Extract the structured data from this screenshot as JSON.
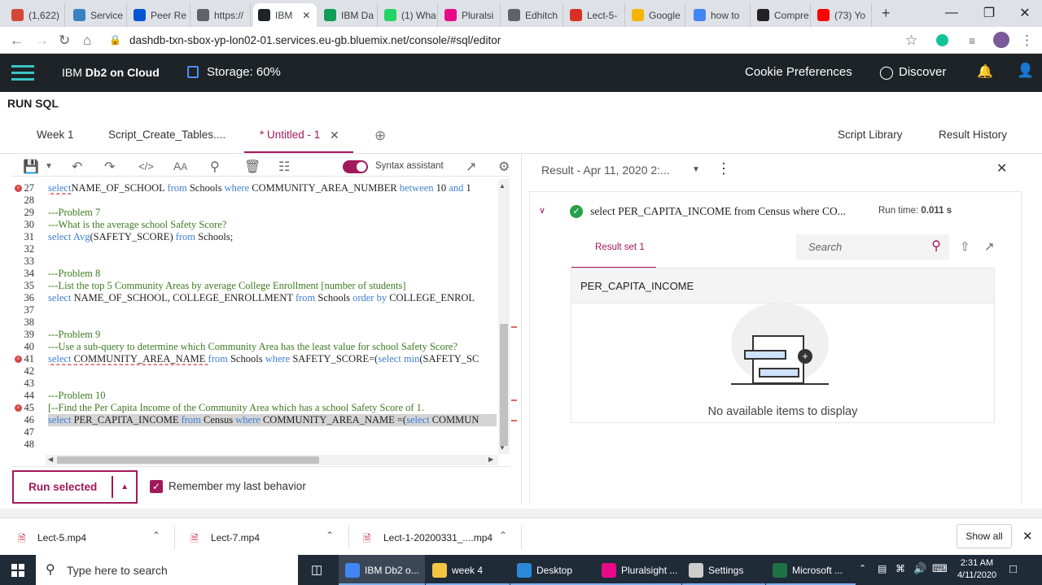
{
  "browser": {
    "tabs": [
      {
        "label": "(1,622)",
        "icon": "gmail-icon",
        "color": "#d44638"
      },
      {
        "label": "Service",
        "icon": "cloud-icon",
        "color": "#3b82c4"
      },
      {
        "label": "Peer Re",
        "icon": "coursera-icon",
        "color": "#0056d2"
      },
      {
        "label": "https://",
        "icon": "globe-icon",
        "color": "#5f6368"
      },
      {
        "label": "IBM",
        "icon": "ibm-icon",
        "color": "#1d2327"
      },
      {
        "label": "IBM Da",
        "icon": "sheets-icon",
        "color": "#0f9d58"
      },
      {
        "label": "(1) Wha",
        "icon": "whatsapp-icon",
        "color": "#25d366"
      },
      {
        "label": "Pluralsi",
        "icon": "pluralsight-icon",
        "color": "#e80a89"
      },
      {
        "label": "Edhitch",
        "icon": "globe-icon",
        "color": "#5f6368"
      },
      {
        "label": "Lect-5-",
        "icon": "calendar-icon",
        "color": "#d93025"
      },
      {
        "label": "Google",
        "icon": "drive-icon",
        "color": "#f4b400"
      },
      {
        "label": "how to",
        "icon": "google-icon",
        "color": "#4285f4"
      },
      {
        "label": "Compre",
        "icon": "ps-icon",
        "color": "#222"
      },
      {
        "label": "(73) Yo",
        "icon": "youtube-icon",
        "color": "#ff0000"
      }
    ],
    "new_tab": "+",
    "url": "dashdb-txn-sbox-yp-lon02-01.services.eu-gb.bluemix.net/console/#sql/editor"
  },
  "app": {
    "brand_prefix": "IBM",
    "brand_name": "Db2 on Cloud",
    "storage": "Storage: 60%",
    "cookie": "Cookie Preferences",
    "discover": "Discover"
  },
  "page": {
    "title": "RUN SQL",
    "tabs": [
      "Week 1",
      "Script_Create_Tables....",
      "* Untitled - 1"
    ],
    "script_library": "Script Library",
    "result_history": "Result History",
    "syntax_assistant": "Syntax assistant"
  },
  "editor": {
    "lines": [
      {
        "n": "27",
        "err": true,
        "parts": [
          [
            "kw",
            "select"
          ],
          [
            "",
            "NAME_OF_SCHOOL "
          ],
          [
            "kw",
            "from"
          ],
          [
            "",
            " Schools "
          ],
          [
            "kw",
            "where"
          ],
          [
            "",
            " COMMUNITY_AREA_NUMBER "
          ],
          [
            "kw",
            "between"
          ],
          [
            "",
            " 10 "
          ],
          [
            "kw",
            "and"
          ],
          [
            "",
            " 1"
          ]
        ]
      },
      {
        "n": "28",
        "parts": []
      },
      {
        "n": "29",
        "parts": [
          [
            "cm",
            "---Problem 7"
          ]
        ]
      },
      {
        "n": "30",
        "parts": [
          [
            "cm",
            "---What is the average school Safety Score?"
          ]
        ]
      },
      {
        "n": "31",
        "parts": [
          [
            "kw",
            "select"
          ],
          [
            "",
            " "
          ],
          [
            "kw",
            "Avg"
          ],
          [
            "",
            "(SAFETY_SCORE) "
          ],
          [
            "kw",
            "from"
          ],
          [
            "",
            " Schools;"
          ]
        ]
      },
      {
        "n": "32",
        "parts": []
      },
      {
        "n": "33",
        "parts": []
      },
      {
        "n": "34",
        "parts": [
          [
            "cm",
            "---Problem 8"
          ]
        ]
      },
      {
        "n": "35",
        "parts": [
          [
            "cm",
            "---List the top 5 Community Areas by average College Enrollment [number of students]"
          ]
        ]
      },
      {
        "n": "36",
        "parts": [
          [
            "kw",
            "select"
          ],
          [
            "",
            " NAME_OF_SCHOOL, COLLEGE_ENROLLMENT "
          ],
          [
            "kw",
            "from"
          ],
          [
            "",
            " Schools "
          ],
          [
            "kw",
            "order by"
          ],
          [
            "",
            " COLLEGE_ENROL"
          ]
        ]
      },
      {
        "n": "37",
        "parts": []
      },
      {
        "n": "38",
        "parts": []
      },
      {
        "n": "39",
        "parts": [
          [
            "cm",
            "---Problem 9"
          ]
        ]
      },
      {
        "n": "40",
        "parts": [
          [
            "cm",
            "---Use a sub-query to determine which Community Area has the least value for school Safety Score?"
          ]
        ]
      },
      {
        "n": "41",
        "err": true,
        "parts": [
          [
            "kw",
            "select"
          ],
          [
            "",
            " COMMUNITY_AREA_NAME "
          ],
          [
            "kw",
            "from"
          ],
          [
            "",
            " Schools "
          ],
          [
            "kw",
            "where"
          ],
          [
            "",
            " SAFETY_SCORE=("
          ],
          [
            "kw",
            "select"
          ],
          [
            "",
            " "
          ],
          [
            "kw",
            "min"
          ],
          [
            "",
            "(SAFETY_SC"
          ]
        ]
      },
      {
        "n": "42",
        "parts": []
      },
      {
        "n": "43",
        "parts": []
      },
      {
        "n": "44",
        "parts": [
          [
            "cm",
            "---Problem 10"
          ]
        ]
      },
      {
        "n": "45",
        "err": true,
        "parts": [
          [
            "cm",
            "[--Find the Per Capita Income of the Community Area which has a school Safety Score of 1."
          ]
        ]
      },
      {
        "n": "46",
        "sel": true,
        "parts": [
          [
            "kw",
            "select"
          ],
          [
            "",
            " PER_CAPITA_INCOME "
          ],
          [
            "kw",
            "from"
          ],
          [
            "",
            " Census "
          ],
          [
            "kw",
            "where"
          ],
          [
            "",
            " COMMUNITY_AREA_NAME =("
          ],
          [
            "kw",
            "select"
          ],
          [
            "",
            " COMMUN"
          ]
        ]
      },
      {
        "n": "47",
        "parts": []
      },
      {
        "n": "48",
        "parts": []
      }
    ],
    "run_button": "Run selected",
    "remember": "Remember my last behavior"
  },
  "result": {
    "header": "Result - Apr 11, 2020 2:...",
    "query": "select PER_CAPITA_INCOME from Census where CO...",
    "runtime_label": "Run time:",
    "runtime_value": "0.011 s",
    "tab": "Result set 1",
    "search_placeholder": "Search",
    "column": "PER_CAPITA_INCOME",
    "empty": "No available items to display"
  },
  "downloads": {
    "items": [
      "Lect-5.mp4",
      "Lect-7.mp4",
      "Lect-1-20200331_....mp4"
    ],
    "show_all": "Show all"
  },
  "taskbar": {
    "search": "Type here to search",
    "items": [
      {
        "label": "IBM Db2 o...",
        "color": "#4285f4"
      },
      {
        "label": "week 4",
        "color": "#f4c542"
      },
      {
        "label": "Desktop",
        "color": "#2b88d8"
      },
      {
        "label": "Pluralsight ...",
        "color": "#e80a89"
      },
      {
        "label": "Settings",
        "color": "#cccccc"
      },
      {
        "label": "Microsoft ...",
        "color": "#1e7145"
      }
    ],
    "time": "2:31 AM",
    "date": "4/11/2020"
  },
  "colors": {
    "accent": "#a2195b",
    "header_bg": "#1d2327",
    "success": "#24a148"
  }
}
